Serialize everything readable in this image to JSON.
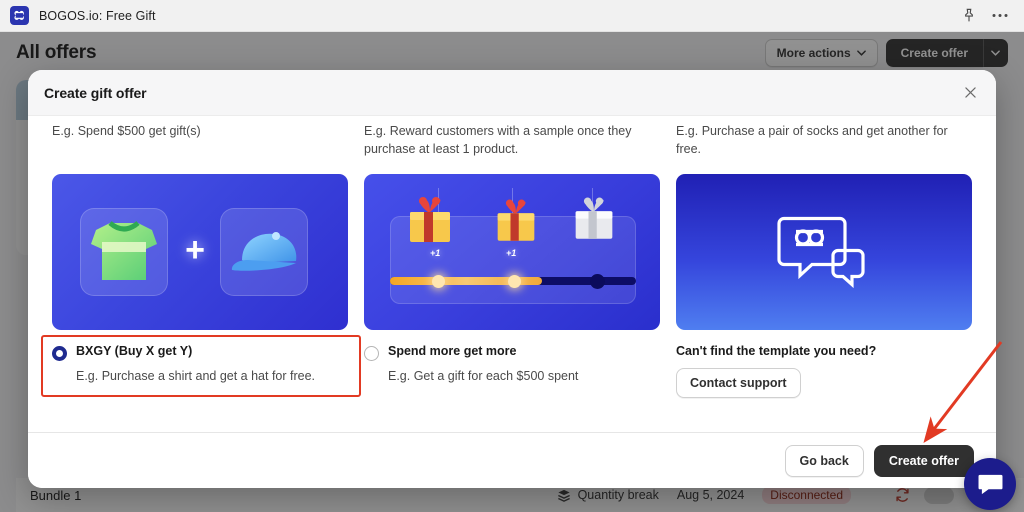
{
  "topbar": {
    "app_title": "BOGOS.io: Free Gift",
    "logo_icon": "bogos-logo-icon",
    "pin_icon": "pin-icon",
    "more_icon": "more-horizontal-icon"
  },
  "page": {
    "title": "All offers",
    "more_actions_label": "More actions",
    "create_offer_label": "Create offer",
    "chevron_icon": "chevron-down-icon",
    "row": {
      "name": "Bundle 1",
      "type_icon": "layers-icon",
      "type": "Quantity break",
      "date": "Aug 5, 2024",
      "status": "Disconnected",
      "refresh_icon": "refresh-icon",
      "toggle_icon": "toggle-switch",
      "duplicate_icon": "duplicate-icon",
      "delete_icon": "trash-icon"
    }
  },
  "modal": {
    "title": "Create gift offer",
    "close_icon": "close-icon",
    "templates": [
      {
        "description": "E.g. Spend $500 get gift(s)",
        "tile_icon": "shirt-plus-cap-illustration",
        "plus": "+",
        "option_label": "BXGY (Buy X get Y)",
        "option_sub": "E.g. Purchase a shirt and get a hat for free.",
        "selected": true
      },
      {
        "description": "E.g. Reward customers with a sample once they purchase at least 1 product.",
        "tile_icon": "gift-tiers-slider-illustration",
        "tier_labels": [
          "+1",
          "+1"
        ],
        "option_label": "Spend more get more",
        "option_sub": "E.g. Get a gift for each $500 spent",
        "selected": false
      },
      {
        "description": "E.g. Purchase a pair of socks and get another for free.",
        "tile_icon": "chat-bubble-logo-illustration"
      }
    ],
    "support": {
      "title": "Can't find the template you need?",
      "button_label": "Contact support"
    },
    "footer": {
      "go_back_label": "Go back",
      "create_offer_label": "Create offer"
    }
  },
  "annotation": {
    "arrow_color": "#e23a23",
    "highlight_color": "#e23a23"
  },
  "chat_widget": {
    "icon": "chat-bubble-icon",
    "color": "#1c1c8c"
  }
}
